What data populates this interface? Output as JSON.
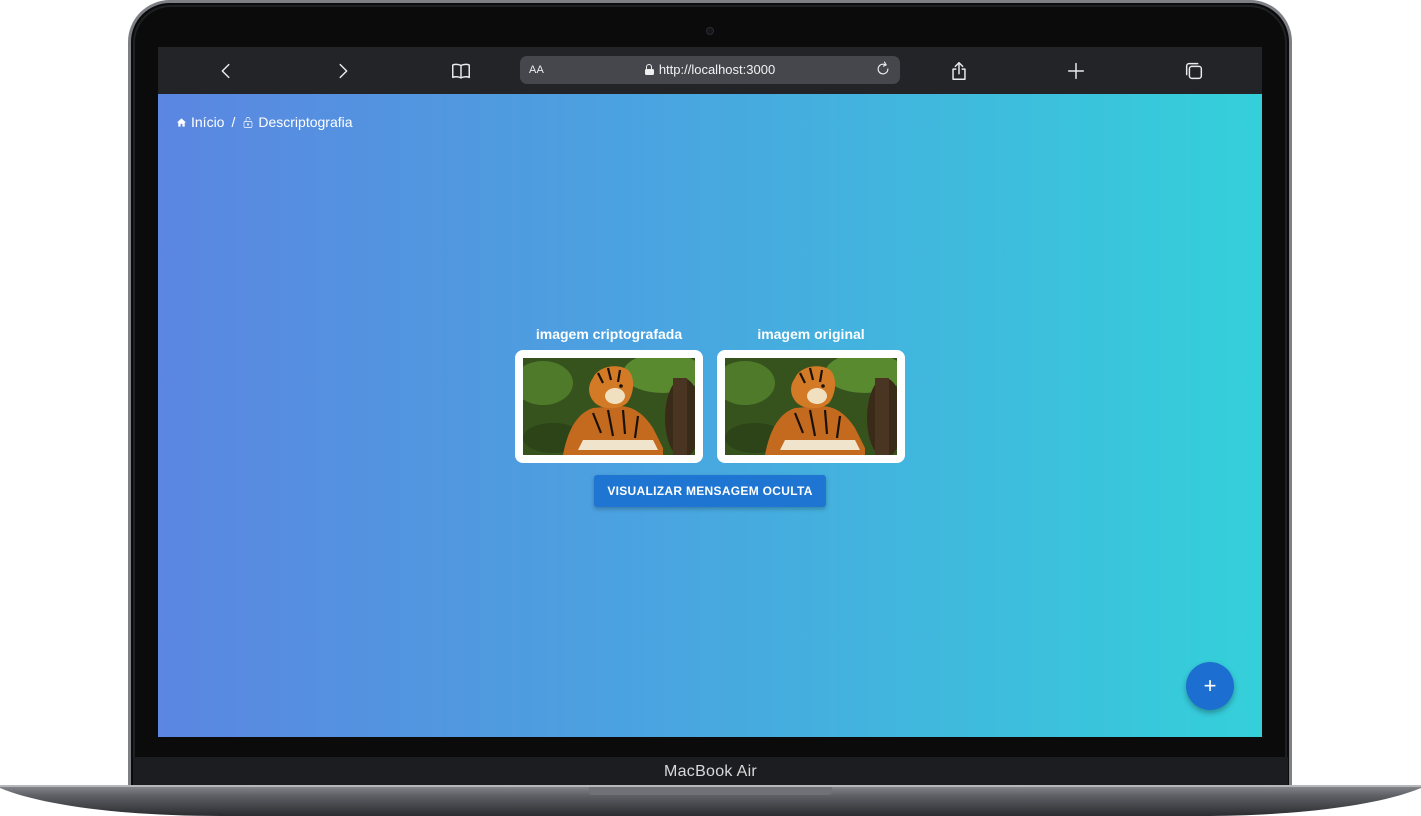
{
  "device": {
    "model_label": "MacBook Air"
  },
  "browser": {
    "text_size_label": "AA",
    "url": "http://localhost:3000",
    "icons": {
      "back": "chevron-left-icon",
      "forward": "chevron-right-icon",
      "bookmarks": "book-icon",
      "reload": "reload-icon",
      "share": "share-icon",
      "new_tab": "plus-icon",
      "tabs": "tabs-icon"
    }
  },
  "breadcrumb": {
    "home_label": "Início",
    "separator": "/",
    "current_label": "Descriptografia"
  },
  "images": {
    "encrypted_caption": "imagem criptografada",
    "original_caption": "imagem original",
    "subject": "tiger-photo"
  },
  "actions": {
    "reveal_button_label": "VISUALIZAR MENSAGEM OCULTA",
    "fab_label": "+"
  },
  "colors": {
    "gradient_start": "#5b86e1",
    "gradient_end": "#34d0da",
    "primary_button": "#1f76d2",
    "fab": "#1c6fd1",
    "browser_bar": "#232427",
    "address_bar": "#45474c"
  }
}
